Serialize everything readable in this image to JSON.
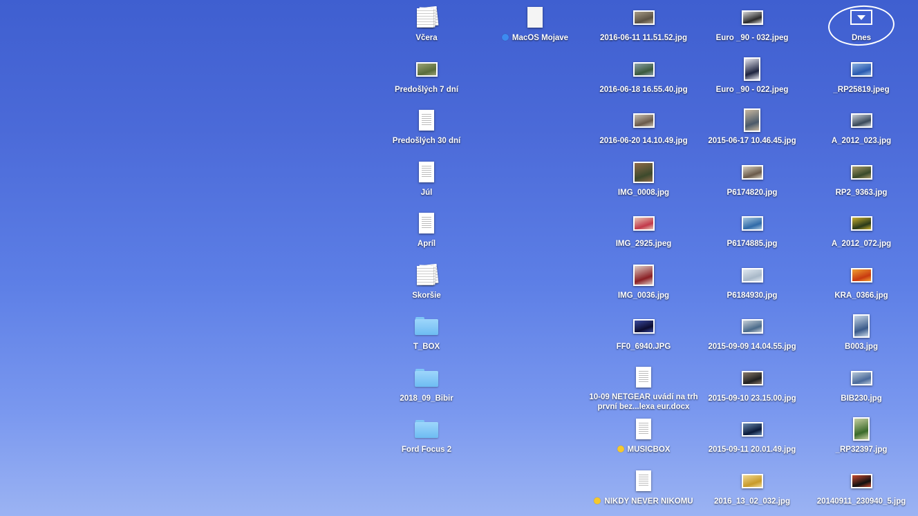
{
  "colors": {
    "blue_tag": "#3d8bf0",
    "yellow_tag": "#f5c82e"
  },
  "columns": [
    {
      "items": [
        {
          "label": "Včera",
          "icon": "stack-icon",
          "kind": "stack"
        },
        {
          "label": "Predošlých 7 dní",
          "icon": "photo-stack-icon",
          "kind": "photo",
          "c1": "#5a6d3a",
          "c2": "#9aa276"
        },
        {
          "label": "Predošlých 30 dní",
          "icon": "document-icon",
          "kind": "doc"
        },
        {
          "label": "Júl",
          "icon": "document-icon",
          "kind": "doc"
        },
        {
          "label": "Apríl",
          "icon": "document-icon",
          "kind": "doc"
        },
        {
          "label": "Skoršie",
          "icon": "docx-stack-icon",
          "kind": "stack"
        },
        {
          "label": "T_BOX",
          "icon": "folder-icon",
          "kind": "folder"
        },
        {
          "label": "2018_09_Bibir",
          "icon": "folder-icon",
          "kind": "folder"
        },
        {
          "label": "Ford Focus 2",
          "icon": "folder-icon",
          "kind": "folder"
        }
      ]
    },
    {
      "items": [
        {
          "label": "MacOS Mojave",
          "icon": "blank-document-icon",
          "kind": "doc",
          "tag": "blue"
        }
      ]
    },
    {
      "items": [
        {
          "label": "2016-06-11 11.51.52.jpg",
          "icon": "image-thumbnail-icon",
          "kind": "photo",
          "c1": "#5b5244",
          "c2": "#a79b86"
        },
        {
          "label": "2016-06-18 16.55.40.jpg",
          "icon": "image-thumbnail-icon",
          "kind": "photo",
          "c1": "#3b5a3e",
          "c2": "#8aa0a8"
        },
        {
          "label": "2016-06-20 14.10.49.jpg",
          "icon": "image-thumbnail-icon",
          "kind": "photo",
          "c1": "#6a5a4a",
          "c2": "#c9c1b2"
        },
        {
          "label": "IMG_0008.jpg",
          "icon": "image-thumbnail-icon",
          "kind": "photo",
          "c1": "#3d4a2c",
          "c2": "#8e6a4a",
          "tall": true
        },
        {
          "label": "IMG_2925.jpeg",
          "icon": "image-thumbnail-icon",
          "kind": "photo",
          "c1": "#c2394a",
          "c2": "#e8c8b8"
        },
        {
          "label": "IMG_0036.jpg",
          "icon": "image-thumbnail-icon",
          "kind": "photo",
          "c1": "#8a1f24",
          "c2": "#e0d0c8",
          "tall": true
        },
        {
          "label": "FF0_6940.JPG",
          "icon": "image-thumbnail-icon",
          "kind": "photo",
          "c1": "#0d0d30",
          "c2": "#3a4aa0"
        },
        {
          "label": "10-09 NETGEAR uvádí na trh první bez...lexa eur.docx",
          "icon": "docx-icon",
          "kind": "doc",
          "wrap": true
        },
        {
          "label": "MUSICBOX",
          "icon": "document-icon",
          "kind": "doc",
          "tag": "yellow"
        },
        {
          "label": "NIKDY NEVER NIKOMU",
          "icon": "document-icon",
          "kind": "doc",
          "tag": "yellow"
        }
      ]
    },
    {
      "items": [
        {
          "label": "Euro _90 - 032.jpeg",
          "icon": "image-thumbnail-icon",
          "kind": "photo",
          "c1": "#2a2a2a",
          "c2": "#d8d8d8"
        },
        {
          "label": "Euro _90 - 022.jpeg",
          "icon": "image-thumbnail-icon",
          "kind": "photo",
          "c1": "#1e2440",
          "c2": "#e8e8f0",
          "portrait": true
        },
        {
          "label": "2015-06-17 10.46.45.jpg",
          "icon": "image-thumbnail-icon",
          "kind": "photo",
          "c1": "#4a5a6a",
          "c2": "#c8b8a0",
          "portrait": true
        },
        {
          "label": "P6174820.jpg",
          "icon": "image-thumbnail-icon",
          "kind": "photo",
          "c1": "#6a5a4a",
          "c2": "#d8d0c0"
        },
        {
          "label": "P6174885.jpg",
          "icon": "image-thumbnail-icon",
          "kind": "photo",
          "c1": "#2f6aa8",
          "c2": "#a8c8e0"
        },
        {
          "label": "P6184930.jpg",
          "icon": "image-thumbnail-icon",
          "kind": "photo",
          "c1": "#a8b8c8",
          "c2": "#e0e8f0"
        },
        {
          "label": "2015-09-09 14.04.55.jpg",
          "icon": "image-thumbnail-icon",
          "kind": "photo",
          "c1": "#4a6a8a",
          "c2": "#c8d0d8"
        },
        {
          "label": "2015-09-10 23.15.00.jpg",
          "icon": "image-thumbnail-icon",
          "kind": "photo",
          "c1": "#202020",
          "c2": "#8a7a6a"
        },
        {
          "label": "2015-09-11 20.01.49.jpg",
          "icon": "image-thumbnail-icon",
          "kind": "photo",
          "c1": "#0a1a3a",
          "c2": "#6a8ab0"
        },
        {
          "label": "2016_13_02_032.jpg",
          "icon": "image-thumbnail-icon",
          "kind": "photo",
          "c1": "#c89a2a",
          "c2": "#f0d890"
        }
      ]
    },
    {
      "items": [
        {
          "label": "Dnes",
          "icon": "stack-download-icon",
          "kind": "dnes"
        },
        {
          "label": "_RP25819.jpeg",
          "icon": "image-thumbnail-icon",
          "kind": "photo",
          "c1": "#2a5ab0",
          "c2": "#8ab0e0"
        },
        {
          "label": "A_2012_023.jpg",
          "icon": "image-thumbnail-icon",
          "kind": "photo",
          "c1": "#3a4a5a",
          "c2": "#c8d0d8"
        },
        {
          "label": "RP2_9363.jpg",
          "icon": "image-thumbnail-icon",
          "kind": "photo",
          "c1": "#3a4a2a",
          "c2": "#a89a6a"
        },
        {
          "label": "A_2012_072.jpg",
          "icon": "image-thumbnail-icon",
          "kind": "photo",
          "c1": "#2a3a1a",
          "c2": "#c8b030"
        },
        {
          "label": "KRA_0366.jpg",
          "icon": "image-thumbnail-icon",
          "kind": "photo",
          "c1": "#c83a10",
          "c2": "#f0a030"
        },
        {
          "label": "B003.jpg",
          "icon": "image-thumbnail-icon",
          "kind": "photo",
          "c1": "#3a5a8a",
          "c2": "#c8d8e8",
          "portrait": true
        },
        {
          "label": "BIB230.jpg",
          "icon": "image-thumbnail-icon",
          "kind": "photo",
          "c1": "#4a6a9a",
          "c2": "#b8c8d8"
        },
        {
          "label": "_RP32397.jpg",
          "icon": "image-thumbnail-icon",
          "kind": "photo",
          "c1": "#3a6a2a",
          "c2": "#c8d0a0",
          "portrait": true
        },
        {
          "label": "20140911_230940_5.jpg",
          "icon": "image-thumbnail-icon",
          "kind": "photo",
          "c1": "#101010",
          "c2": "#c84a30"
        }
      ]
    }
  ]
}
